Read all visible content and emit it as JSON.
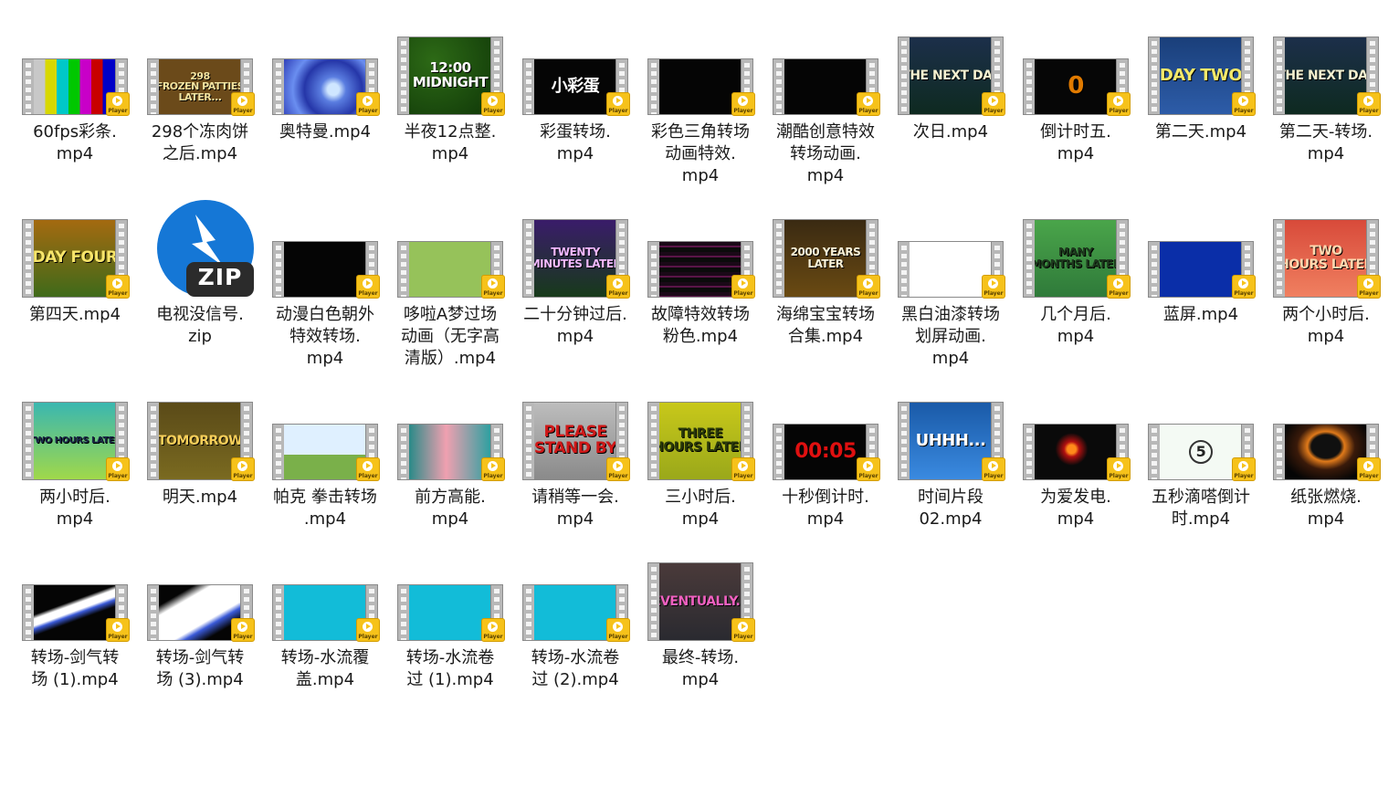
{
  "badge_text": "Player",
  "files": [
    {
      "name": "60fps彩条.\nmp4",
      "thumb": "bars",
      "text": ""
    },
    {
      "name": "298个冻肉饼\n之后.mp4",
      "thumb": "brown",
      "text": "298\nFROZEN PATTIES\nLATER..."
    },
    {
      "name": "奥特曼.mp4",
      "thumb": "blueswirl",
      "text": ""
    },
    {
      "name": "半夜12点整.\nmp4",
      "thumb": "green-tall",
      "text": "12:00\nMIDNIGHT"
    },
    {
      "name": "彩蛋转场.\nmp4",
      "thumb": "black",
      "text": "小彩蛋"
    },
    {
      "name": "彩色三角转场\n动画特效.\nmp4",
      "thumb": "black",
      "text": ""
    },
    {
      "name": "潮酷创意特效\n转场动画.\nmp4",
      "thumb": "black",
      "text": ""
    },
    {
      "name": "次日.mp4",
      "thumb": "darkgreen-tall",
      "text": "THE NEXT DAY"
    },
    {
      "name": "倒计时五.\nmp4",
      "thumb": "darkorange",
      "text": "0"
    },
    {
      "name": "第二天.mp4",
      "thumb": "blue-tall",
      "text": "DAY TWO"
    },
    {
      "name": "第二天-转场.\nmp4",
      "thumb": "darkgreen-tall",
      "text": "THE NEXT DAY"
    },
    {
      "name": "第四天.mp4",
      "thumb": "orange-tall",
      "text": "DAY FOUR"
    },
    {
      "name": "电视没信号.\nzip",
      "thumb": "zip",
      "text": "ZIP"
    },
    {
      "name": "动漫白色朝外\n特效转场.\nmp4",
      "thumb": "black",
      "text": ""
    },
    {
      "name": "哆啦A梦过场\n动画（无字高\n清版）.mp4",
      "thumb": "olive",
      "text": ""
    },
    {
      "name": "二十分钟过后.\nmp4",
      "thumb": "purple-tall",
      "text": "TWENTY\nMINUTES LATER"
    },
    {
      "name": "故障特效转场\n粉色.mp4",
      "thumb": "glitch",
      "text": ""
    },
    {
      "name": "海绵宝宝转场\n合集.mp4",
      "thumb": "brown-tall",
      "text": "2000 YEARS\nLATER"
    },
    {
      "name": "黑白油漆转场\n划屏动画.\nmp4",
      "thumb": "white",
      "text": ""
    },
    {
      "name": "几个月后.\nmp4",
      "thumb": "green-tall2",
      "text": "MANY\nMONTHS LATER"
    },
    {
      "name": "蓝屏.mp4",
      "thumb": "bluescreen",
      "text": ""
    },
    {
      "name": "两个小时后.\nmp4",
      "thumb": "red-tall",
      "text": "TWO\nHOURS LATER"
    },
    {
      "name": "两小时后.\nmp4",
      "thumb": "teal-tall",
      "text": "TWO HOURS LATER"
    },
    {
      "name": "明天.mp4",
      "thumb": "khaki-tall",
      "text": "TOMORROW"
    },
    {
      "name": "帕克 拳击转场\n.mp4",
      "thumb": "anime",
      "text": ""
    },
    {
      "name": "前方高能.\nmp4",
      "thumb": "teal",
      "text": ""
    },
    {
      "name": "请稍等一会.\nmp4",
      "thumb": "gray-tall",
      "text": "PLEASE\nSTAND BY"
    },
    {
      "name": "三小时后.\nmp4",
      "thumb": "yellow-tall",
      "text": "THREE\nHOURS LATER"
    },
    {
      "name": "十秒倒计时.\nmp4",
      "thumb": "countdown",
      "text": "00:05"
    },
    {
      "name": "时间片段\n02.mp4",
      "thumb": "blue2-tall",
      "text": "UHHH..."
    },
    {
      "name": "为爱发电.\nmp4",
      "thumb": "blackred",
      "text": ""
    },
    {
      "name": "五秒滴嗒倒计\n时.mp4",
      "thumb": "lightcount",
      "text": "5"
    },
    {
      "name": "纸张燃烧.\nmp4",
      "thumb": "burn",
      "text": ""
    },
    {
      "name": "转场-剑气转\n场 (1).mp4",
      "thumb": "slash",
      "text": ""
    },
    {
      "name": "转场-剑气转\n场 (3).mp4",
      "thumb": "slash2",
      "text": ""
    },
    {
      "name": "转场-水流覆\n盖.mp4",
      "thumb": "cyan",
      "text": ""
    },
    {
      "name": "转场-水流卷\n过 (1).mp4",
      "thumb": "cyan",
      "text": ""
    },
    {
      "name": "转场-水流卷\n过 (2).mp4",
      "thumb": "cyan",
      "text": ""
    },
    {
      "name": "最终-转场.\nmp4",
      "thumb": "wood-tall",
      "text": "EVENTUALLY..."
    }
  ]
}
